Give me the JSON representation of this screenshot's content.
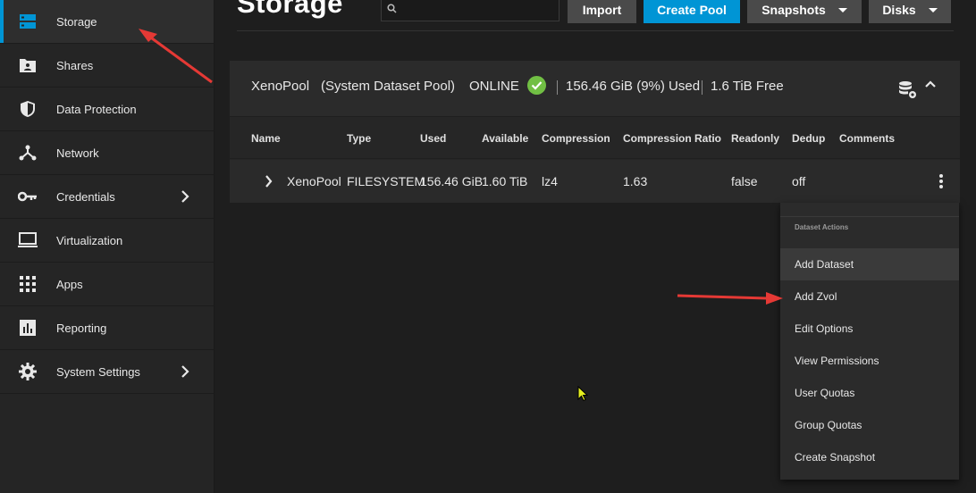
{
  "sidebar": {
    "items": [
      {
        "label": "Storage",
        "icon": "storage-icon"
      },
      {
        "label": "Shares",
        "icon": "folder-share-icon"
      },
      {
        "label": "Data Protection",
        "icon": "shield-icon"
      },
      {
        "label": "Network",
        "icon": "network-icon"
      },
      {
        "label": "Credentials",
        "icon": "key-icon"
      },
      {
        "label": "Virtualization",
        "icon": "monitor-icon"
      },
      {
        "label": "Apps",
        "icon": "apps-grid-icon"
      },
      {
        "label": "Reporting",
        "icon": "chart-icon"
      },
      {
        "label": "System Settings",
        "icon": "gear-icon"
      }
    ]
  },
  "header": {
    "title": "Storage",
    "search_placeholder": "",
    "import_label": "Import",
    "create_pool_label": "Create Pool",
    "snapshots_label": "Snapshots",
    "disks_label": "Disks"
  },
  "pool": {
    "name": "XenoPool",
    "subtitle": "(System Dataset Pool)",
    "status": "ONLINE",
    "used": "156.46 GiB (9%) Used",
    "free": "1.6 TiB Free"
  },
  "table": {
    "columns": [
      "Name",
      "Type",
      "Used",
      "Available",
      "Compression",
      "Compression Ratio",
      "Readonly",
      "Dedup",
      "Comments"
    ],
    "rows": [
      {
        "name": "XenoPool",
        "type": "FILESYSTEM",
        "used": "156.46 GiB",
        "available": "1.60 TiB",
        "compression": "lz4",
        "ratio": "1.63",
        "readonly": "false",
        "dedup": "off",
        "comments": ""
      }
    ]
  },
  "menu": {
    "heading": "Dataset Actions",
    "items": [
      "Add Dataset",
      "Add Zvol",
      "Edit Options",
      "View Permissions",
      "User Quotas",
      "Group Quotas",
      "Create Snapshot"
    ]
  },
  "colors": {
    "accent": "#0095d5",
    "online": "#71bf44",
    "annotation_arrow": "#e53935"
  }
}
